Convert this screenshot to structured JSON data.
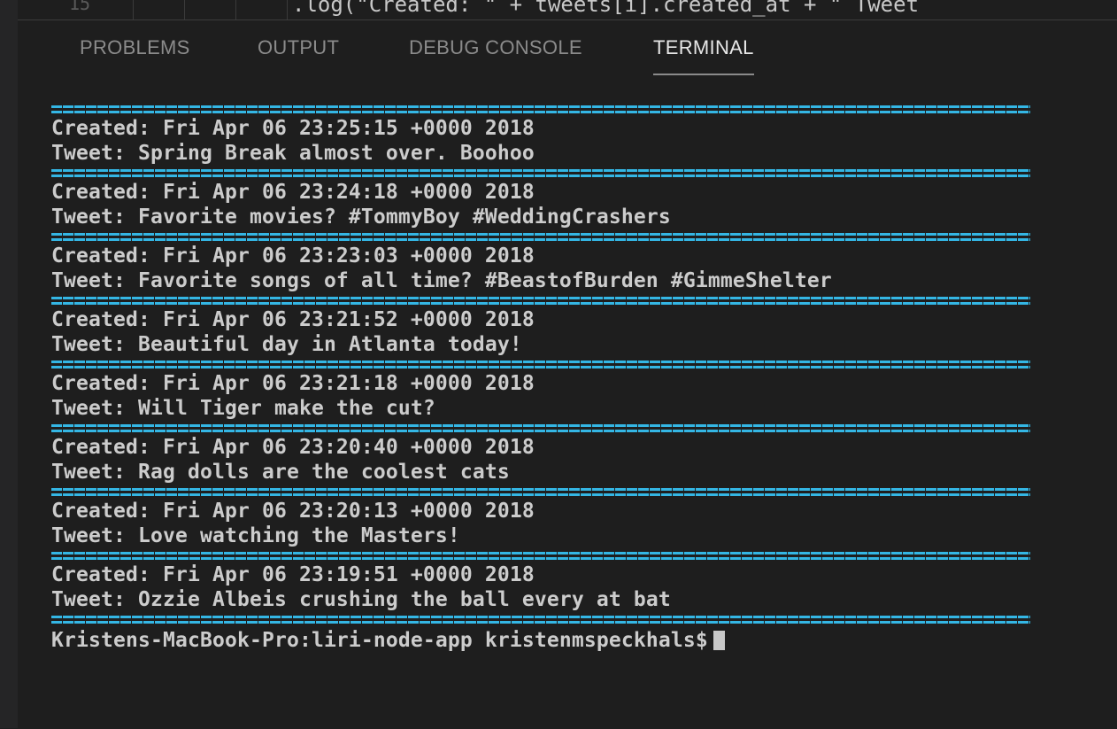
{
  "editor": {
    "line_number": "15",
    "code_fragment": ".log(\"Created: \" + tweets[i].created_at + \"  Tweet"
  },
  "panel": {
    "tabs": [
      {
        "label": "PROBLEMS",
        "active": false
      },
      {
        "label": "OUTPUT",
        "active": false
      },
      {
        "label": "DEBUG CONSOLE",
        "active": false
      },
      {
        "label": "TERMINAL",
        "active": true
      }
    ]
  },
  "terminal": {
    "separator_color": "#34b6e4",
    "tweets": [
      {
        "created": "Created: Fri Apr 06 23:25:15 +0000 2018",
        "tweet": "Tweet: Spring Break almost over. Boohoo"
      },
      {
        "created": "Created: Fri Apr 06 23:24:18 +0000 2018",
        "tweet": "Tweet: Favorite movies? #TommyBoy #WeddingCrashers"
      },
      {
        "created": "Created: Fri Apr 06 23:23:03 +0000 2018",
        "tweet": "Tweet: Favorite songs of all time? #BeastofBurden #GimmeShelter"
      },
      {
        "created": "Created: Fri Apr 06 23:21:52 +0000 2018",
        "tweet": "Tweet: Beautiful day in Atlanta today!"
      },
      {
        "created": "Created: Fri Apr 06 23:21:18 +0000 2018",
        "tweet": "Tweet: Will Tiger make the cut?"
      },
      {
        "created": "Created: Fri Apr 06 23:20:40 +0000 2018",
        "tweet": "Tweet: Rag dolls are the coolest cats"
      },
      {
        "created": "Created: Fri Apr 06 23:20:13 +0000 2018",
        "tweet": "Tweet: Love watching the Masters!"
      },
      {
        "created": "Created: Fri Apr 06 23:19:51 +0000 2018",
        "tweet": "Tweet: Ozzie Albeis crushing the ball every at bat"
      }
    ],
    "prompt": "Kristens-MacBook-Pro:liri-node-app kristenmspeckhals$"
  }
}
